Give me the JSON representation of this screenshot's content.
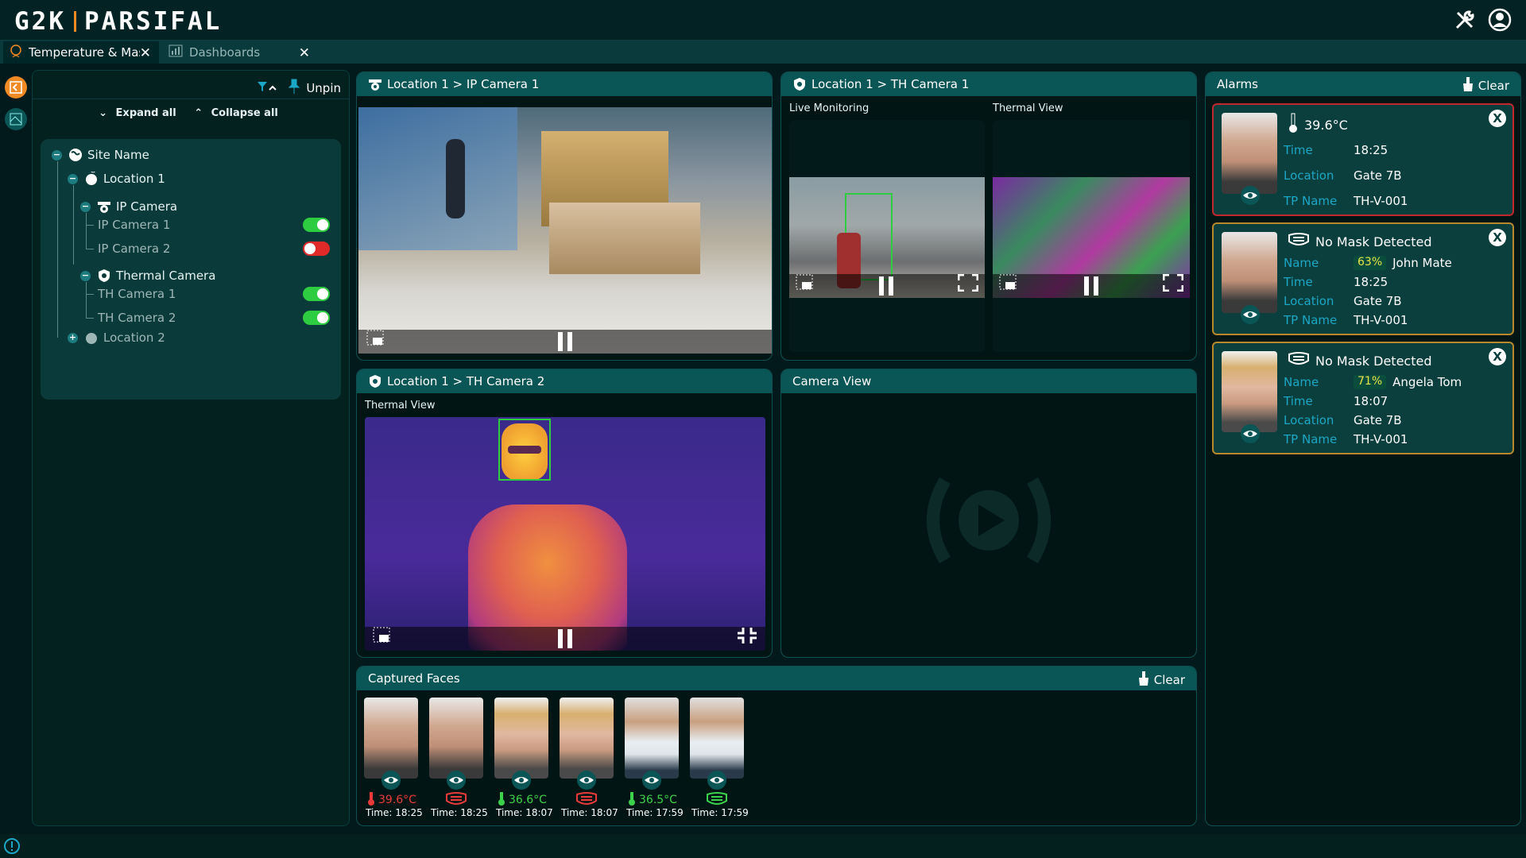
{
  "app": {
    "logo_left": "G2K",
    "logo_right": "PARSIFAL"
  },
  "tabs": [
    {
      "label": "Temperature & Mas...",
      "close": "✕"
    },
    {
      "label": "Dashboards",
      "close": "✕"
    }
  ],
  "tree_panel": {
    "unpin_label": "Unpin",
    "expand_all": "Expand all",
    "collapse_all": "Collapse all",
    "nodes": {
      "site": "Site Name",
      "location1": "Location 1",
      "ip_camera_group": "IP Camera",
      "ip_camera_1": "IP Camera 1",
      "ip_camera_2": "IP Camera 2",
      "thermal_group": "Thermal Camera",
      "th_camera_1": "TH Camera 1",
      "th_camera_2": "TH Camera 2",
      "location2": "Location 2"
    },
    "toggles": {
      "ip_camera_1": true,
      "ip_camera_2": false,
      "th_camera_1": true,
      "th_camera_2": true
    }
  },
  "panels": {
    "ip_cam1": {
      "title": "Location 1 > IP Camera 1"
    },
    "th_cam1": {
      "title": "Location 1 > TH Camera 1",
      "live_label": "Live Monitoring",
      "thermal_label": "Thermal View"
    },
    "th_cam2": {
      "title": "Location 1 > TH Camera 2",
      "thermal_label": "Thermal View"
    },
    "camera_view": {
      "title": "Camera View"
    },
    "captured_faces": {
      "title": "Captured Faces",
      "clear_label": "Clear"
    }
  },
  "alarms": {
    "title": "Alarms",
    "clear_label": "Clear",
    "items": [
      {
        "title": "39.6°C",
        "time_key": "Time",
        "time": "18:25",
        "location_key": "Location",
        "location": "Gate 7B",
        "tp_key": "TP Name",
        "tp": "TH-V-001",
        "border": "#c0282d"
      },
      {
        "title": "No Mask Detected",
        "name_key": "Name",
        "pct": "63%",
        "name": "John Mate",
        "time_key": "Time",
        "time": "18:25",
        "location_key": "Location",
        "location": "Gate 7B",
        "tp_key": "TP Name",
        "tp": "TH-V-001",
        "border": "#b7892c"
      },
      {
        "title": "No Mask Detected",
        "name_key": "Name",
        "pct": "71%",
        "name": "Angela Tom",
        "time_key": "Time",
        "time": "18:07",
        "location_key": "Location",
        "location": "Gate 7B",
        "tp_key": "TP Name",
        "tp": "TH-V-001",
        "border": "#b7892c"
      }
    ]
  },
  "captured_faces": [
    {
      "value": "39.6°C",
      "type": "temp-high",
      "time": "Time: 18:25",
      "color": "#e83a3a"
    },
    {
      "value": "",
      "type": "mask-alert",
      "time": "Time: 18:25",
      "color": "#e83a3a"
    },
    {
      "value": "36.6°C",
      "type": "temp-ok",
      "time": "Time: 18:07",
      "color": "#3bd14a"
    },
    {
      "value": "",
      "type": "mask-alert",
      "time": "Time: 18:07",
      "color": "#e83a3a"
    },
    {
      "value": "36.5°C",
      "type": "temp-ok",
      "time": "Time: 17:59",
      "color": "#3bd14a"
    },
    {
      "value": "",
      "type": "mask-ok",
      "time": "Time: 17:59",
      "color": "#3bd14a"
    }
  ],
  "colors": {
    "accent": "#0a5556",
    "brand": "#f08a24",
    "alert": "#e83a3a",
    "ok": "#3bd14a",
    "label_blue": "#1ba7c6"
  }
}
